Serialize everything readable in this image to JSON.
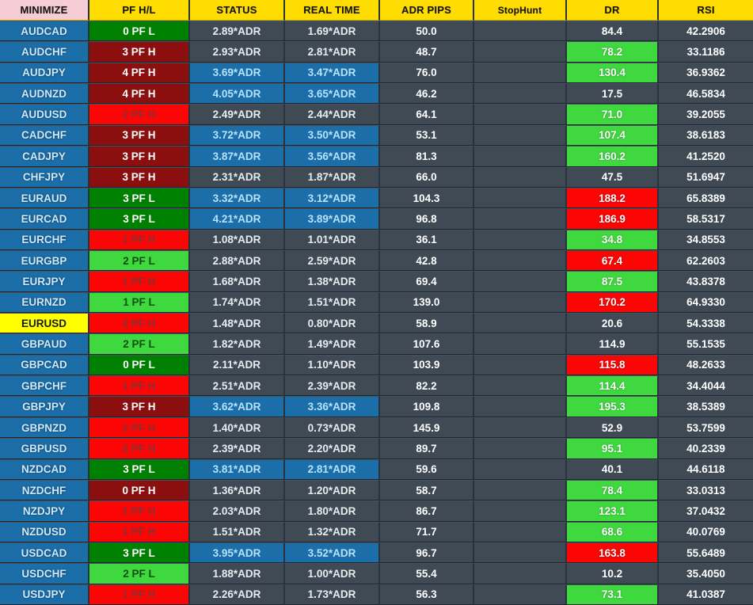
{
  "header": {
    "columns": [
      {
        "label": "MINIMIZE",
        "style": "pink"
      },
      {
        "label": "PF H/L",
        "style": "yellow"
      },
      {
        "label": "STATUS",
        "style": "yellow"
      },
      {
        "label": "REAL TIME",
        "style": "yellow"
      },
      {
        "label": "ADR PIPS",
        "style": "yellow"
      },
      {
        "label": "StopHunt",
        "style": "yellow"
      },
      {
        "label": "DR",
        "style": "yellow"
      },
      {
        "label": "RSI",
        "style": "yellow"
      }
    ]
  },
  "colors": {
    "header_yellow": "#ffdd00",
    "header_pink": "#f6ccd6",
    "symbol_blue": "#1b6ea8",
    "symbol_selected": "#ffff00",
    "cell_gray": "#3f4a55",
    "pf_dark_green": "#008000",
    "pf_light_green": "#3fd93f",
    "pf_dark_red": "#8b0f0f",
    "pf_bright_red": "#fb0505",
    "dr_green": "#3fd93f",
    "dr_red": "#fb0505",
    "panel_bg": "#29333d"
  },
  "rows": [
    {
      "symbol": "AUDCAD",
      "selected": false,
      "pf": "0 PF L",
      "pf_style": "pf-dgreen",
      "status": "2.89*ADR",
      "status_style": "st-gray",
      "real_time": "1.69*ADR",
      "real_style": "st-gray",
      "adr_pips": "50.0",
      "stop_hunt": "",
      "dr": "84.4",
      "dr_style": "dr-none",
      "rsi": "42.2906"
    },
    {
      "symbol": "AUDCHF",
      "selected": false,
      "pf": "3 PF H",
      "pf_style": "pf-dred",
      "status": "2.93*ADR",
      "status_style": "st-gray",
      "real_time": "2.81*ADR",
      "real_style": "st-gray",
      "adr_pips": "48.7",
      "stop_hunt": "",
      "dr": "78.2",
      "dr_style": "dr-green",
      "rsi": "33.1186"
    },
    {
      "symbol": "AUDJPY",
      "selected": false,
      "pf": "4 PF H",
      "pf_style": "pf-dred",
      "status": "3.69*ADR",
      "status_style": "st-blue",
      "real_time": "3.47*ADR",
      "real_style": "st-blue",
      "adr_pips": "76.0",
      "stop_hunt": "",
      "dr": "130.4",
      "dr_style": "dr-green",
      "rsi": "36.9362"
    },
    {
      "symbol": "AUDNZD",
      "selected": false,
      "pf": "4 PF H",
      "pf_style": "pf-dred",
      "status": "4.05*ADR",
      "status_style": "st-blue",
      "real_time": "3.65*ADR",
      "real_style": "st-blue",
      "adr_pips": "46.2",
      "stop_hunt": "",
      "dr": "17.5",
      "dr_style": "dr-none",
      "rsi": "46.5834"
    },
    {
      "symbol": "AUDUSD",
      "selected": false,
      "pf": "2 PF H",
      "pf_style": "pf-lred",
      "status": "2.49*ADR",
      "status_style": "st-gray",
      "real_time": "2.44*ADR",
      "real_style": "st-gray",
      "adr_pips": "64.1",
      "stop_hunt": "",
      "dr": "71.0",
      "dr_style": "dr-green",
      "rsi": "39.2055"
    },
    {
      "symbol": "CADCHF",
      "selected": false,
      "pf": "3 PF H",
      "pf_style": "pf-dred",
      "status": "3.72*ADR",
      "status_style": "st-blue",
      "real_time": "3.50*ADR",
      "real_style": "st-blue",
      "adr_pips": "53.1",
      "stop_hunt": "",
      "dr": "107.4",
      "dr_style": "dr-green",
      "rsi": "38.6183"
    },
    {
      "symbol": "CADJPY",
      "selected": false,
      "pf": "3 PF H",
      "pf_style": "pf-dred",
      "status": "3.87*ADR",
      "status_style": "st-blue",
      "real_time": "3.56*ADR",
      "real_style": "st-blue",
      "adr_pips": "81.3",
      "stop_hunt": "",
      "dr": "160.2",
      "dr_style": "dr-green",
      "rsi": "41.2520"
    },
    {
      "symbol": "CHFJPY",
      "selected": false,
      "pf": "3 PF H",
      "pf_style": "pf-dred",
      "status": "2.31*ADR",
      "status_style": "st-gray",
      "real_time": "1.87*ADR",
      "real_style": "st-gray",
      "adr_pips": "66.0",
      "stop_hunt": "",
      "dr": "47.5",
      "dr_style": "dr-none",
      "rsi": "51.6947"
    },
    {
      "symbol": "EURAUD",
      "selected": false,
      "pf": "3 PF L",
      "pf_style": "pf-dgreen",
      "status": "3.32*ADR",
      "status_style": "st-blue",
      "real_time": "3.12*ADR",
      "real_style": "st-blue",
      "adr_pips": "104.3",
      "stop_hunt": "",
      "dr": "188.2",
      "dr_style": "dr-red",
      "rsi": "65.8389"
    },
    {
      "symbol": "EURCAD",
      "selected": false,
      "pf": "3 PF L",
      "pf_style": "pf-dgreen",
      "status": "4.21*ADR",
      "status_style": "st-blue",
      "real_time": "3.89*ADR",
      "real_style": "st-blue",
      "adr_pips": "96.8",
      "stop_hunt": "",
      "dr": "186.9",
      "dr_style": "dr-red",
      "rsi": "58.5317"
    },
    {
      "symbol": "EURCHF",
      "selected": false,
      "pf": "1 PF H",
      "pf_style": "pf-lred",
      "status": "1.08*ADR",
      "status_style": "st-gray",
      "real_time": "1.01*ADR",
      "real_style": "st-gray",
      "adr_pips": "36.1",
      "stop_hunt": "",
      "dr": "34.8",
      "dr_style": "dr-green",
      "rsi": "34.8553"
    },
    {
      "symbol": "EURGBP",
      "selected": false,
      "pf": "2 PF L",
      "pf_style": "pf-lgreen",
      "status": "2.88*ADR",
      "status_style": "st-gray",
      "real_time": "2.59*ADR",
      "real_style": "st-gray",
      "adr_pips": "42.8",
      "stop_hunt": "",
      "dr": "67.4",
      "dr_style": "dr-red",
      "rsi": "62.2603"
    },
    {
      "symbol": "EURJPY",
      "selected": false,
      "pf": "1 PF H",
      "pf_style": "pf-lred",
      "status": "1.68*ADR",
      "status_style": "st-gray",
      "real_time": "1.38*ADR",
      "real_style": "st-gray",
      "adr_pips": "69.4",
      "stop_hunt": "",
      "dr": "87.5",
      "dr_style": "dr-green",
      "rsi": "43.8378"
    },
    {
      "symbol": "EURNZD",
      "selected": false,
      "pf": "1 PF L",
      "pf_style": "pf-lgreen",
      "status": "1.74*ADR",
      "status_style": "st-gray",
      "real_time": "1.51*ADR",
      "real_style": "st-gray",
      "adr_pips": "139.0",
      "stop_hunt": "",
      "dr": "170.2",
      "dr_style": "dr-red",
      "rsi": "64.9330"
    },
    {
      "symbol": "EURUSD",
      "selected": true,
      "pf": "2 PF H",
      "pf_style": "pf-lred",
      "status": "1.48*ADR",
      "status_style": "st-gray",
      "real_time": "0.80*ADR",
      "real_style": "st-gray",
      "adr_pips": "58.9",
      "stop_hunt": "",
      "dr": "20.6",
      "dr_style": "dr-none",
      "rsi": "54.3338"
    },
    {
      "symbol": "GBPAUD",
      "selected": false,
      "pf": "2 PF L",
      "pf_style": "pf-lgreen",
      "status": "1.82*ADR",
      "status_style": "st-gray",
      "real_time": "1.49*ADR",
      "real_style": "st-gray",
      "adr_pips": "107.6",
      "stop_hunt": "",
      "dr": "114.9",
      "dr_style": "dr-none",
      "rsi": "55.1535"
    },
    {
      "symbol": "GBPCAD",
      "selected": false,
      "pf": "0 PF L",
      "pf_style": "pf-dgreen",
      "status": "2.11*ADR",
      "status_style": "st-gray",
      "real_time": "1.10*ADR",
      "real_style": "st-gray",
      "adr_pips": "103.9",
      "stop_hunt": "",
      "dr": "115.8",
      "dr_style": "dr-red",
      "rsi": "48.2633"
    },
    {
      "symbol": "GBPCHF",
      "selected": false,
      "pf": "1 PF H",
      "pf_style": "pf-lred",
      "status": "2.51*ADR",
      "status_style": "st-gray",
      "real_time": "2.39*ADR",
      "real_style": "st-gray",
      "adr_pips": "82.2",
      "stop_hunt": "",
      "dr": "114.4",
      "dr_style": "dr-green",
      "rsi": "34.4044"
    },
    {
      "symbol": "GBPJPY",
      "selected": false,
      "pf": "3 PF H",
      "pf_style": "pf-dred",
      "status": "3.62*ADR",
      "status_style": "st-blue",
      "real_time": "3.36*ADR",
      "real_style": "st-blue",
      "adr_pips": "109.8",
      "stop_hunt": "",
      "dr": "195.3",
      "dr_style": "dr-green",
      "rsi": "38.5389"
    },
    {
      "symbol": "GBPNZD",
      "selected": false,
      "pf": "2 PF H",
      "pf_style": "pf-lred",
      "status": "1.40*ADR",
      "status_style": "st-gray",
      "real_time": "0.73*ADR",
      "real_style": "st-gray",
      "adr_pips": "145.9",
      "stop_hunt": "",
      "dr": "52.9",
      "dr_style": "dr-none",
      "rsi": "53.7599"
    },
    {
      "symbol": "GBPUSD",
      "selected": false,
      "pf": "2 PF H",
      "pf_style": "pf-lred",
      "status": "2.39*ADR",
      "status_style": "st-gray",
      "real_time": "2.20*ADR",
      "real_style": "st-gray",
      "adr_pips": "89.7",
      "stop_hunt": "",
      "dr": "95.1",
      "dr_style": "dr-green",
      "rsi": "40.2339"
    },
    {
      "symbol": "NZDCAD",
      "selected": false,
      "pf": "3 PF L",
      "pf_style": "pf-dgreen",
      "status": "3.81*ADR",
      "status_style": "st-blue",
      "real_time": "2.81*ADR",
      "real_style": "st-blue",
      "adr_pips": "59.6",
      "stop_hunt": "",
      "dr": "40.1",
      "dr_style": "dr-none",
      "rsi": "44.6118"
    },
    {
      "symbol": "NZDCHF",
      "selected": false,
      "pf": "0 PF H",
      "pf_style": "pf-dred",
      "status": "1.36*ADR",
      "status_style": "st-gray",
      "real_time": "1.20*ADR",
      "real_style": "st-gray",
      "adr_pips": "58.7",
      "stop_hunt": "",
      "dr": "78.4",
      "dr_style": "dr-green",
      "rsi": "33.0313"
    },
    {
      "symbol": "NZDJPY",
      "selected": false,
      "pf": "1 PF H",
      "pf_style": "pf-lred",
      "status": "2.03*ADR",
      "status_style": "st-gray",
      "real_time": "1.80*ADR",
      "real_style": "st-gray",
      "adr_pips": "86.7",
      "stop_hunt": "",
      "dr": "123.1",
      "dr_style": "dr-green",
      "rsi": "37.0432"
    },
    {
      "symbol": "NZDUSD",
      "selected": false,
      "pf": "1 PF H",
      "pf_style": "pf-lred",
      "status": "1.51*ADR",
      "status_style": "st-gray",
      "real_time": "1.32*ADR",
      "real_style": "st-gray",
      "adr_pips": "71.7",
      "stop_hunt": "",
      "dr": "68.6",
      "dr_style": "dr-green",
      "rsi": "40.0769"
    },
    {
      "symbol": "USDCAD",
      "selected": false,
      "pf": "3 PF L",
      "pf_style": "pf-dgreen",
      "status": "3.95*ADR",
      "status_style": "st-blue",
      "real_time": "3.52*ADR",
      "real_style": "st-blue",
      "adr_pips": "96.7",
      "stop_hunt": "",
      "dr": "163.8",
      "dr_style": "dr-red",
      "rsi": "55.6489"
    },
    {
      "symbol": "USDCHF",
      "selected": false,
      "pf": "2 PF L",
      "pf_style": "pf-lgreen",
      "status": "1.88*ADR",
      "status_style": "st-gray",
      "real_time": "1.00*ADR",
      "real_style": "st-gray",
      "adr_pips": "55.4",
      "stop_hunt": "",
      "dr": "10.2",
      "dr_style": "dr-none",
      "rsi": "35.4050"
    },
    {
      "symbol": "USDJPY",
      "selected": false,
      "pf": "1 PF H",
      "pf_style": "pf-lred",
      "status": "2.26*ADR",
      "status_style": "st-gray",
      "real_time": "1.73*ADR",
      "real_style": "st-gray",
      "adr_pips": "56.3",
      "stop_hunt": "",
      "dr": "73.1",
      "dr_style": "dr-green",
      "rsi": "41.0387"
    }
  ]
}
